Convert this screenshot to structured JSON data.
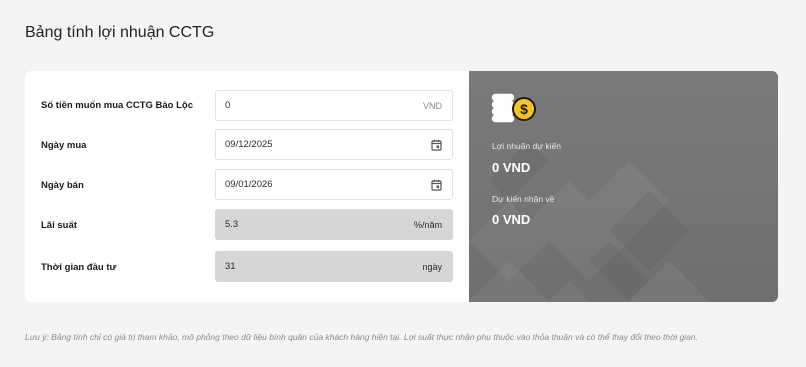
{
  "page": {
    "title": "Bảng tính lợi nhuận CCTG",
    "note": "Lưu ý: Bảng tính chỉ có giá trị tham khảo, mô phỏng theo dữ liệu bình quân của khách hàng hiện tại. Lợi suất thực nhận phụ thuộc vào thỏa thuận và có thể thay đổi theo thời gian."
  },
  "form": {
    "amount": {
      "label": "Số tiền muốn mua CCTG Bảo Lộc",
      "value": "0",
      "unit": "VND"
    },
    "buy_date": {
      "label": "Ngày mua",
      "value": "09/12/2025",
      "icon": "calendar-icon"
    },
    "sell_date": {
      "label": "Ngày bán",
      "value": "09/01/2026",
      "icon": "calendar-icon"
    },
    "rate": {
      "label": "Lãi suất",
      "value": "5.3",
      "unit": "%/năm"
    },
    "duration": {
      "label": "Thời gian đầu tư",
      "value": "31",
      "unit": "ngày"
    }
  },
  "result": {
    "icon": "coins-dollar-icon",
    "expected_profit_label": "Lợi nhuận dự kiến",
    "expected_profit_value": "0 VND",
    "expected_receive_label": "Dự kiến nhận về",
    "expected_receive_value": "0 VND"
  },
  "colors": {
    "panel_gray": "#767676",
    "coin_yellow": "#f5c518",
    "readonly_field": "#d6d6d6",
    "background": "#f4f4f4"
  }
}
